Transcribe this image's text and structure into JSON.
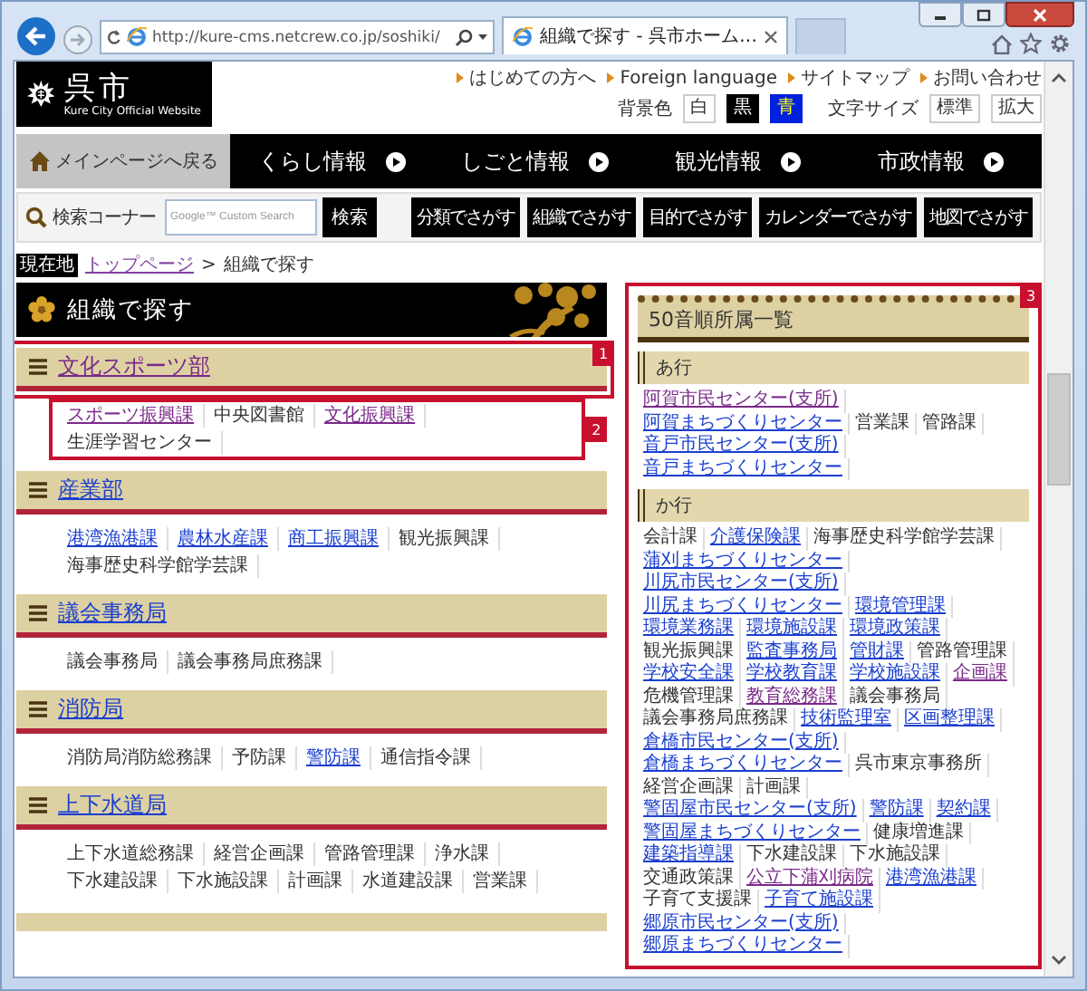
{
  "browser": {
    "url": "http://kure-cms.netcrew.co.jp/soshiki/",
    "tab_title": "組織で探す - 呉市ホーム…"
  },
  "logo": {
    "name": "呉市",
    "subtitle": "Kure City Official Website"
  },
  "header_links": [
    "はじめての方へ",
    "Foreign language",
    "サイトマップ",
    "お問い合わせ"
  ],
  "background_color": {
    "label": "背景色",
    "options": [
      {
        "label": "白",
        "kind": "white"
      },
      {
        "label": "黒",
        "kind": "black"
      },
      {
        "label": "青",
        "kind": "blue"
      }
    ]
  },
  "text_size": {
    "label": "文字サイズ",
    "options": [
      "標準",
      "拡大"
    ]
  },
  "nav": {
    "home": "メインページへ戻る",
    "items": [
      "くらし情報",
      "しごと情報",
      "観光情報",
      "市政情報"
    ]
  },
  "search": {
    "label": "検索コーナー",
    "placeholder": "Google™ Custom Search",
    "button": "検索",
    "finders": [
      "分類でさがす",
      "組織でさがす",
      "目的でさがす",
      "カレンダーでさがす",
      "地図でさがす"
    ]
  },
  "breadcrumb": {
    "badge": "現在地",
    "parent": "トップページ",
    "separator": ">",
    "current": "組織で探す"
  },
  "page_title": "組織で探す",
  "departments": [
    {
      "name": "文化スポーツ部",
      "kind": "visited",
      "annotation": "1",
      "sections_annotation": "2",
      "sections": [
        {
          "name": "スポーツ振興課",
          "kind": "visited"
        },
        {
          "name": "中央図書館",
          "kind": "text"
        },
        {
          "name": "文化振興課",
          "kind": "visited"
        },
        {
          "name": "生涯学習センター",
          "kind": "text"
        }
      ]
    },
    {
      "name": "産業部",
      "kind": "link",
      "sections": [
        {
          "name": "港湾漁港課",
          "kind": "link"
        },
        {
          "name": "農林水産課",
          "kind": "link"
        },
        {
          "name": "商工振興課",
          "kind": "link"
        },
        {
          "name": "観光振興課",
          "kind": "text"
        },
        {
          "name": "海事歴史科学館学芸課",
          "kind": "text"
        }
      ]
    },
    {
      "name": "議会事務局",
      "kind": "link",
      "sections": [
        {
          "name": "議会事務局",
          "kind": "text"
        },
        {
          "name": "議会事務局庶務課",
          "kind": "text"
        }
      ]
    },
    {
      "name": "消防局",
      "kind": "link",
      "sections": [
        {
          "name": "消防局消防総務課",
          "kind": "text"
        },
        {
          "name": "予防課",
          "kind": "text"
        },
        {
          "name": "警防課",
          "kind": "link"
        },
        {
          "name": "通信指令課",
          "kind": "text"
        }
      ]
    },
    {
      "name": "上下水道局",
      "kind": "link",
      "sections": [
        {
          "name": "上下水道総務課",
          "kind": "text"
        },
        {
          "name": "経営企画課",
          "kind": "text"
        },
        {
          "name": "管路管理課",
          "kind": "text"
        },
        {
          "name": "浄水課",
          "kind": "text"
        },
        {
          "name": "下水建設課",
          "kind": "text"
        },
        {
          "name": "下水施設課",
          "kind": "text"
        },
        {
          "name": "計画課",
          "kind": "text"
        },
        {
          "name": "水道建設課",
          "kind": "text"
        },
        {
          "name": "営業課",
          "kind": "text"
        }
      ]
    }
  ],
  "index_panel": {
    "title": "50音順所属一覧",
    "annotation": "3",
    "groups": [
      {
        "heading": "あ行",
        "items": [
          {
            "name": "阿賀市民センター(支所)",
            "kind": "visited"
          },
          {
            "name": "阿賀まちづくりセンター",
            "kind": "link"
          },
          {
            "name": "営業課",
            "kind": "text"
          },
          {
            "name": "管路課",
            "kind": "text"
          },
          {
            "name": "音戸市民センター(支所)",
            "kind": "link"
          },
          {
            "name": "音戸まちづくりセンター",
            "kind": "link"
          }
        ]
      },
      {
        "heading": "か行",
        "items": [
          {
            "name": "会計課",
            "kind": "text"
          },
          {
            "name": "介護保険課",
            "kind": "link"
          },
          {
            "name": "海事歴史科学館学芸課",
            "kind": "text"
          },
          {
            "name": "蒲刈まちづくりセンター",
            "kind": "link"
          },
          {
            "name": "川尻市民センター(支所)",
            "kind": "link"
          },
          {
            "name": "川尻まちづくりセンター",
            "kind": "link"
          },
          {
            "name": "環境管理課",
            "kind": "link"
          },
          {
            "name": "環境業務課",
            "kind": "link"
          },
          {
            "name": "環境施設課",
            "kind": "link"
          },
          {
            "name": "環境政策課",
            "kind": "link"
          },
          {
            "name": "観光振興課",
            "kind": "text"
          },
          {
            "name": "監査事務局",
            "kind": "link"
          },
          {
            "name": "管財課",
            "kind": "link"
          },
          {
            "name": "管路管理課",
            "kind": "text"
          },
          {
            "name": "学校安全課",
            "kind": "link"
          },
          {
            "name": "学校教育課",
            "kind": "link"
          },
          {
            "name": "学校施設課",
            "kind": "link"
          },
          {
            "name": "企画課",
            "kind": "visited"
          },
          {
            "name": "危機管理課",
            "kind": "text"
          },
          {
            "name": "教育総務課",
            "kind": "visited"
          },
          {
            "name": "議会事務局",
            "kind": "text"
          },
          {
            "name": "議会事務局庶務課",
            "kind": "text"
          },
          {
            "name": "技術監理室",
            "kind": "link"
          },
          {
            "name": "区画整理課",
            "kind": "link"
          },
          {
            "name": "倉橋市民センター(支所)",
            "kind": "link"
          },
          {
            "name": "倉橋まちづくりセンター",
            "kind": "link"
          },
          {
            "name": "呉市東京事務所",
            "kind": "text"
          },
          {
            "name": "経営企画課",
            "kind": "text"
          },
          {
            "name": "計画課",
            "kind": "text"
          },
          {
            "name": "警固屋市民センター(支所)",
            "kind": "link"
          },
          {
            "name": "警防課",
            "kind": "link"
          },
          {
            "name": "契約課",
            "kind": "link"
          },
          {
            "name": "警固屋まちづくりセンター",
            "kind": "link"
          },
          {
            "name": "健康増進課",
            "kind": "text"
          },
          {
            "name": "建築指導課",
            "kind": "link"
          },
          {
            "name": "下水建設課",
            "kind": "text"
          },
          {
            "name": "下水施設課",
            "kind": "text"
          },
          {
            "name": "交通政策課",
            "kind": "text"
          },
          {
            "name": "公立下蒲刈病院",
            "kind": "visited"
          },
          {
            "name": "港湾漁港課",
            "kind": "link"
          },
          {
            "name": "子育て支援課",
            "kind": "text"
          },
          {
            "name": "子育て施設課",
            "kind": "link"
          },
          {
            "name": "郷原市民センター(支所)",
            "kind": "link"
          },
          {
            "name": "郷原まちづくりセンター",
            "kind": "link"
          }
        ]
      }
    ]
  }
}
